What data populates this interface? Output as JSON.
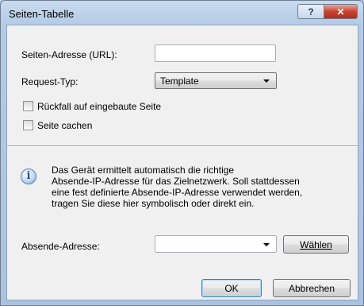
{
  "window": {
    "title": "Seiten-Tabelle",
    "help_glyph": "?",
    "close_glyph": "✕"
  },
  "form": {
    "url_label": "Seiten-Adresse (URL):",
    "url_value": "",
    "request_type_label": "Request-Typ:",
    "request_type_value": "Template",
    "fallback_label": "Rückfall auf eingebaute Seite",
    "fallback_checked": false,
    "cache_label": "Seite cachen",
    "cache_checked": false
  },
  "info": {
    "icon": "info-icon",
    "icon_glyph": "i",
    "line1": "Das Gerät ermittelt automatisch die richtige",
    "line2": "Absende-IP-Adresse für das Zielnetzwerk. Soll stattdessen",
    "line3": "eine fest definierte Absende-IP-Adresse verwendet werden,",
    "line4": "tragen Sie diese hier symbolisch oder direkt ein."
  },
  "sender": {
    "label": "Absende-Adresse:",
    "value": "",
    "choose_button": "Wählen"
  },
  "buttons": {
    "ok": "OK",
    "cancel": "Abbrechen"
  }
}
